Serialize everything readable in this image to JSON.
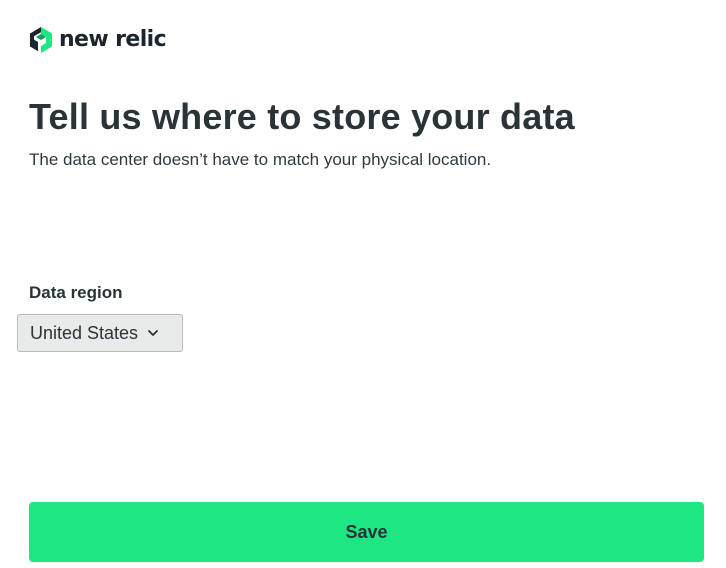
{
  "brand": {
    "name": "new relic",
    "icon": "new-relic-logo-icon",
    "accent_color": "#1ce783",
    "dark_color": "#1d252c"
  },
  "header": {
    "title": "Tell us where to store your data",
    "subtitle": "The data center doesn’t have to match your physical location."
  },
  "region": {
    "label": "Data region",
    "selected": "United States",
    "dropdown_icon": "chevron-down-icon"
  },
  "actions": {
    "save_label": "Save"
  }
}
